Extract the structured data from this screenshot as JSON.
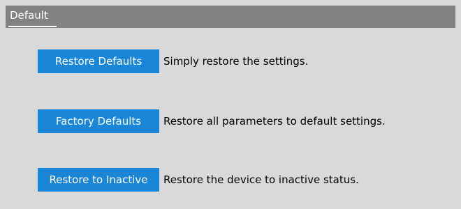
{
  "header": {
    "title": "Default"
  },
  "options": [
    {
      "button_label": "Restore Defaults",
      "description": "Simply restore the settings."
    },
    {
      "button_label": "Factory Defaults",
      "description": "Restore all parameters to default settings."
    },
    {
      "button_label": "Restore to Inactive",
      "description": "Restore the device to inactive status."
    }
  ],
  "colors": {
    "background": "#d9d9d9",
    "header_bg": "#828282",
    "button_bg": "#1a86d8",
    "button_text": "#ffffff",
    "text": "#000000"
  }
}
